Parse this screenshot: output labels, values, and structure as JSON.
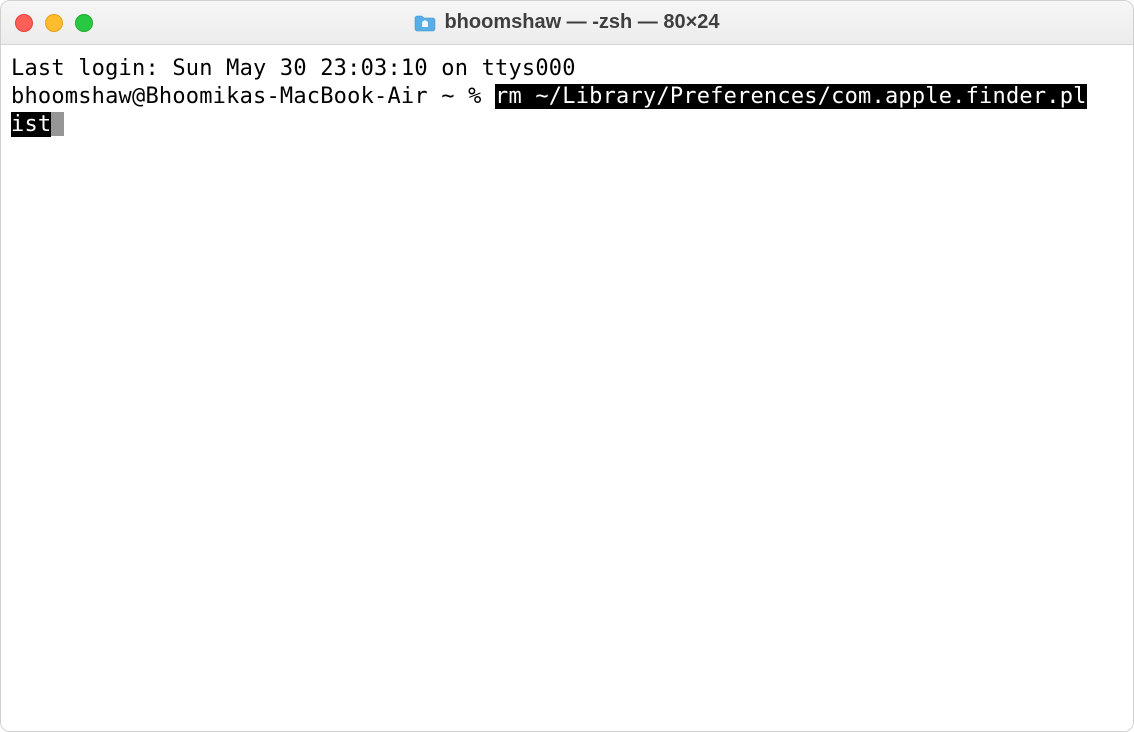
{
  "window": {
    "title": "bhoomshaw — -zsh — 80×24"
  },
  "terminal": {
    "last_login": "Last login: Sun May 30 23:03:10 on ttys000",
    "prompt": "bhoomshaw@Bhoomikas-MacBook-Air ~ % ",
    "command_part1": "rm ~/Library/Preferences/com.apple.finder.pl",
    "command_part2": "ist"
  }
}
